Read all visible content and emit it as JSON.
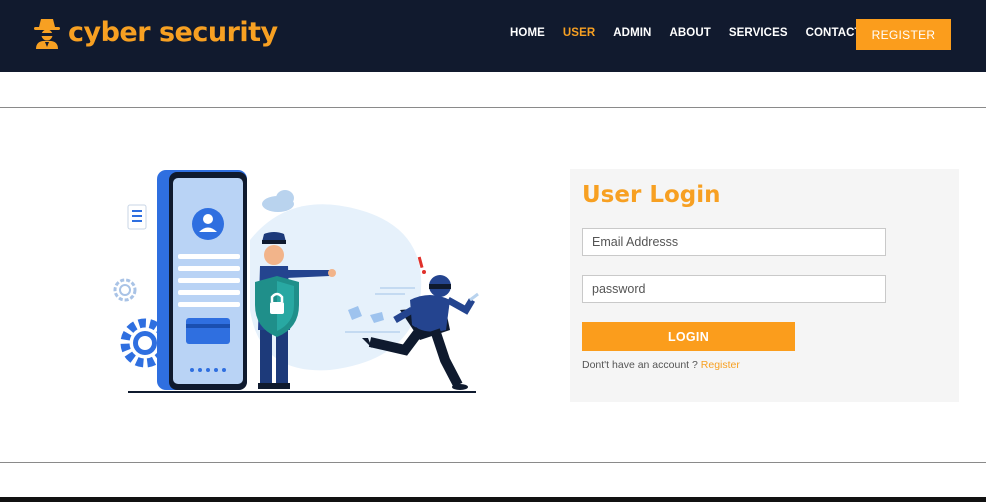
{
  "brand": {
    "name": "cyber security",
    "icon": "spy-agent-icon",
    "color": "#f7a022"
  },
  "nav": {
    "items": [
      {
        "label": "HOME",
        "active": false
      },
      {
        "label": "USER",
        "active": true
      },
      {
        "label": "ADMIN",
        "active": false
      },
      {
        "label": "ABOUT",
        "active": false
      },
      {
        "label": "SERVICES",
        "active": false
      },
      {
        "label": "CONTACT",
        "active": false
      }
    ],
    "register_label": "REGISTER"
  },
  "login": {
    "title": "User Login",
    "email_placeholder": "Email Addresss",
    "password_placeholder": "password",
    "button_label": "LOGIN",
    "signup_prompt": "Dont't have an account ?",
    "signup_link": "Register"
  },
  "colors": {
    "accent": "#fb9d1c",
    "navbar": "#111a2e",
    "panel": "#f5f5f5"
  }
}
